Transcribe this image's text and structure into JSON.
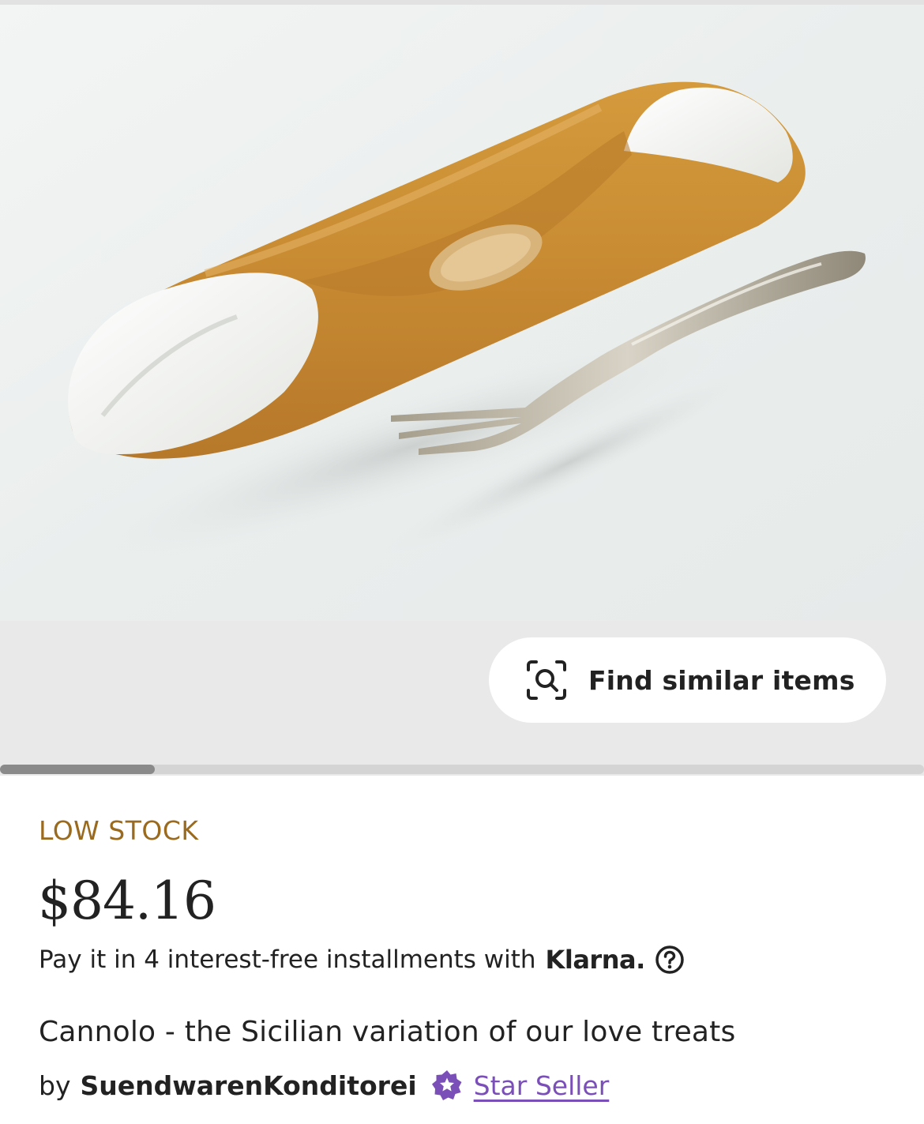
{
  "gallery": {
    "find_similar_label": "Find similar items",
    "image_subject": "Cannolo pastry beside a silver fork"
  },
  "listing": {
    "stock_status": "LOW STOCK",
    "price": "$84.16",
    "installments_text": "Pay it in 4 interest-free installments with",
    "installments_provider": "Klarna.",
    "title": "Cannolo - the Sicilian variation of our love treats",
    "seller_prefix": "by",
    "seller_name": "SuendwarenKonditorei",
    "seller_badge": "Star Seller"
  },
  "colors": {
    "stock": "#9a6a1e",
    "star_seller": "#7b4fb8",
    "text": "#222222",
    "gallery_bg": "#e9e9e9"
  },
  "icons": {
    "find_similar": "camera-search-icon",
    "help": "question-circle-icon",
    "star_seller": "star-badge-icon"
  }
}
